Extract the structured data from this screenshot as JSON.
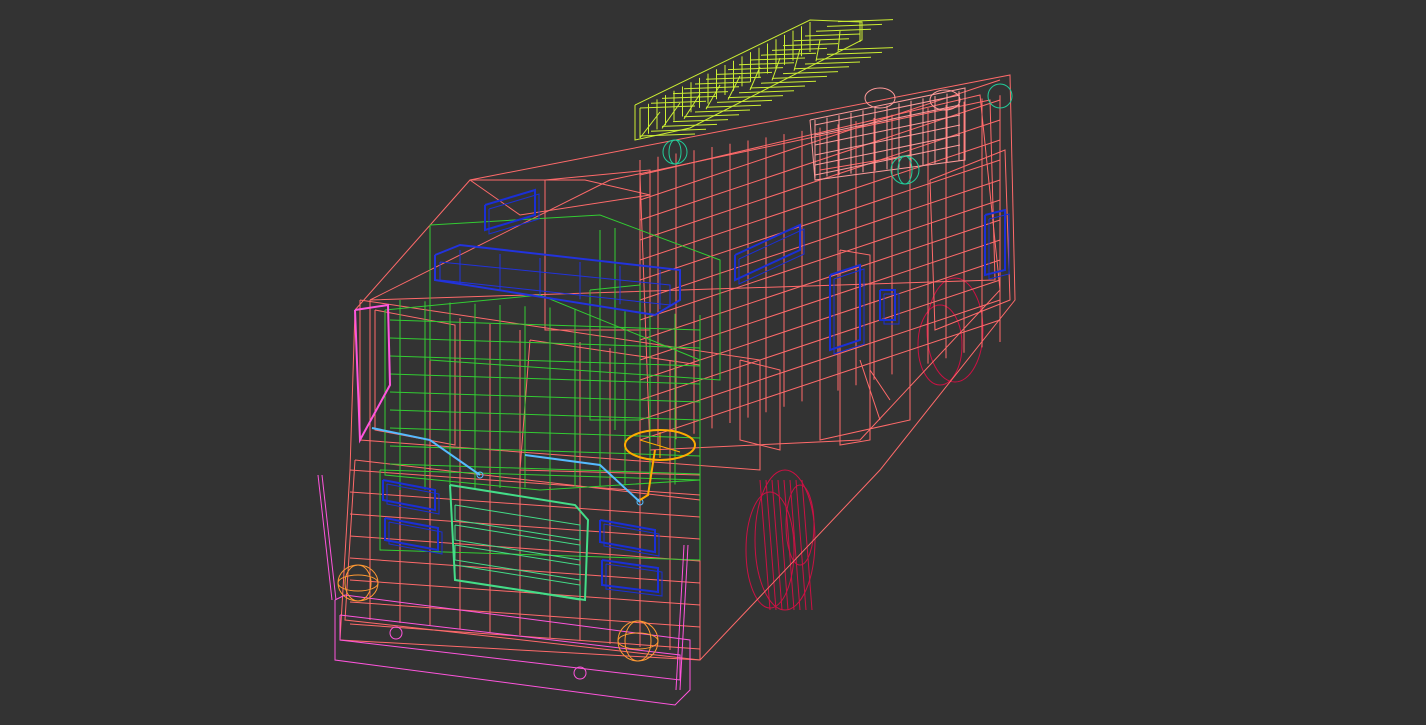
{
  "viewport": {
    "background": "#333333",
    "display_mode": "wireframe"
  },
  "model": {
    "subject": "fire truck",
    "parts": [
      {
        "name": "cab-body",
        "color": "#ff6a6a"
      },
      {
        "name": "cab-interior",
        "color": "#33cc33"
      },
      {
        "name": "bumper",
        "color": "#ff55dd"
      },
      {
        "name": "ladder",
        "color": "#ccee33"
      },
      {
        "name": "light-bar",
        "color": "#2233dd"
      },
      {
        "name": "windows-trim",
        "color": "#1a2fd6"
      },
      {
        "name": "wipers",
        "color": "#55bbff"
      },
      {
        "name": "steering-wheel",
        "color": "#ffaa00"
      },
      {
        "name": "fog-lights",
        "color": "#ff9933"
      },
      {
        "name": "wheels",
        "color": "#cc1144"
      },
      {
        "name": "hose-reels",
        "color": "#ff9999"
      },
      {
        "name": "grille",
        "color": "#44dd88"
      },
      {
        "name": "beacons",
        "color": "#22cc99"
      }
    ]
  }
}
